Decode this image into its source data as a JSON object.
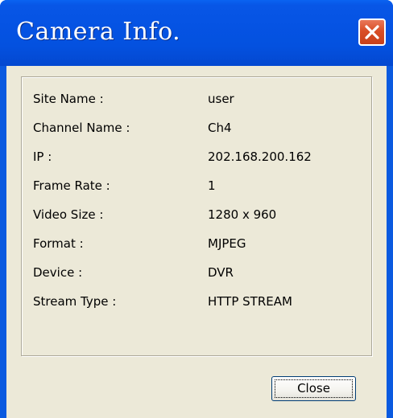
{
  "window": {
    "title": "Camera Info."
  },
  "info": {
    "rows": [
      {
        "label": "Site Name :",
        "value": "user"
      },
      {
        "label": "Channel Name :",
        "value": "Ch4"
      },
      {
        "label": "IP :",
        "value": "202.168.200.162"
      },
      {
        "label": "Frame Rate :",
        "value": "1"
      },
      {
        "label": "Video Size :",
        "value": "1280 x 960"
      },
      {
        "label": "Format :",
        "value": "MJPEG"
      },
      {
        "label": "Device :",
        "value": "DVR"
      },
      {
        "label": "Stream Type :",
        "value": "HTTP STREAM"
      }
    ]
  },
  "footer": {
    "close_label": "Close"
  },
  "colors": {
    "titlebar": "#0553e3",
    "dialog_face": "#ece9d8",
    "close_x_button": "#d94e26"
  },
  "icons": {
    "titlebar_close": "close-icon"
  }
}
